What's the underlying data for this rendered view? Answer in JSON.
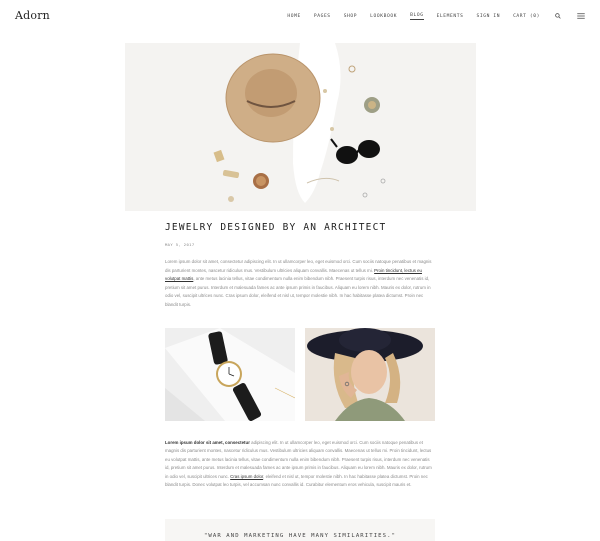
{
  "header": {
    "logo": "Adorn",
    "nav": [
      "HOME",
      "PAGES",
      "SHOP",
      "LOOKBOOK",
      "BLOG",
      "ELEMENTS",
      "SIGN IN",
      "CART (0)"
    ],
    "active_nav": "BLOG",
    "search_icon": "search-icon",
    "menu_icon": "hamburger-menu-icon"
  },
  "post": {
    "title": "JEWELRY DESIGNED BY AN ARCHITECT",
    "date": "MAY 5, 2017",
    "para1": {
      "text_a": "Lorem ipsum dolor sit amet, consectetur adipiscing elit. In ut ullamcorper leo, eget euismod orci. Cum sociis natoque penatibus et magnis dis parturient montes, nascetur ridiculus mus. Vestibulum ultricies aliquam convallis. Maecenas ut tellus mi. ",
      "link1": "Proin tincidunt, lectus eu volutpat mattis",
      "text_b": ", ante metus lacinia tellus, vitae condimentum nulla enim bibendum nibh. Praesent turpis risus, interdum nec venenatis id, pretium sit amet purus. Interdum et malesuada fames ac ante ipsum primis in faucibus. Aliquam eu lorem nibh. Mauris ex dolor, rutrum in odio vel, suscipit ultrices nunc. Cras ipsum dolor, eleifend et nisl ut, tempor molestie nibh. In hac habitasse platea dictumst. Proin nec blandit turpis."
    },
    "para2": {
      "bold": "Lorem ipsum dolor sit amet, consectetur",
      "text_a": " adipiscing elit. In ut ullamcorper leo, eget euismod orci. Cum sociis natoque penatibus et magnis dis parturient montes, nascetur ridiculus mus. Vestibulum ultricies aliquam convallis. Maecenas ut tellus mi. Proin tincidunt, lectus eu volutpat mattis, ante metus lacinia tellus, vitae condimentum nulla enim bibendum nibh. Praesent turpis risus, interdum nec venenatis id, pretium sit amet purus. Interdum et malesuada fames ac ante ipsum primis in faucibus. Aliquam eu lorem nibh. Mauris ex dolor, rutrum in odio vel, suscipit ultrices nunc. ",
      "link": "Cras ipsum dolor",
      "text_b": ", eleifend et nisl ut, tempor molestie nibh. In hac habitasse platea dictumst. Proin nec blandit turpis. Donec volutpat leo turpis, vel accumsan nunc convallis id. Curabitur elementum eros vehicula, suscipit mauris et."
    },
    "quote": "\"WAR AND MARKETING HAVE MANY SIMILARITIES.\""
  },
  "colors": {
    "hero_bg": "#f4f3f1",
    "hat": "#c9a57e",
    "text_dark": "#222222",
    "text_muted": "#8a8a8a"
  }
}
